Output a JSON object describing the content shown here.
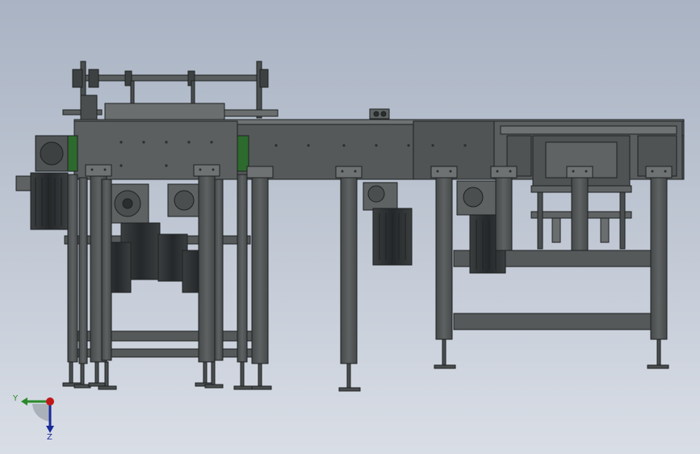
{
  "viewport": {
    "model": "conveyor-assembly",
    "view": "front"
  },
  "triad": {
    "y_label": "Y",
    "z_label": "Z",
    "colors": {
      "y": "#2a8a2a",
      "z": "#1a2a9a",
      "origin": "#c01818"
    }
  },
  "colors": {
    "steel": "#55595a",
    "steel_dark": "#3d4142",
    "steel_light": "#6e7273",
    "motor": "#2b2e2f",
    "green": "#2d6a2d",
    "outline": "#1e2122"
  }
}
